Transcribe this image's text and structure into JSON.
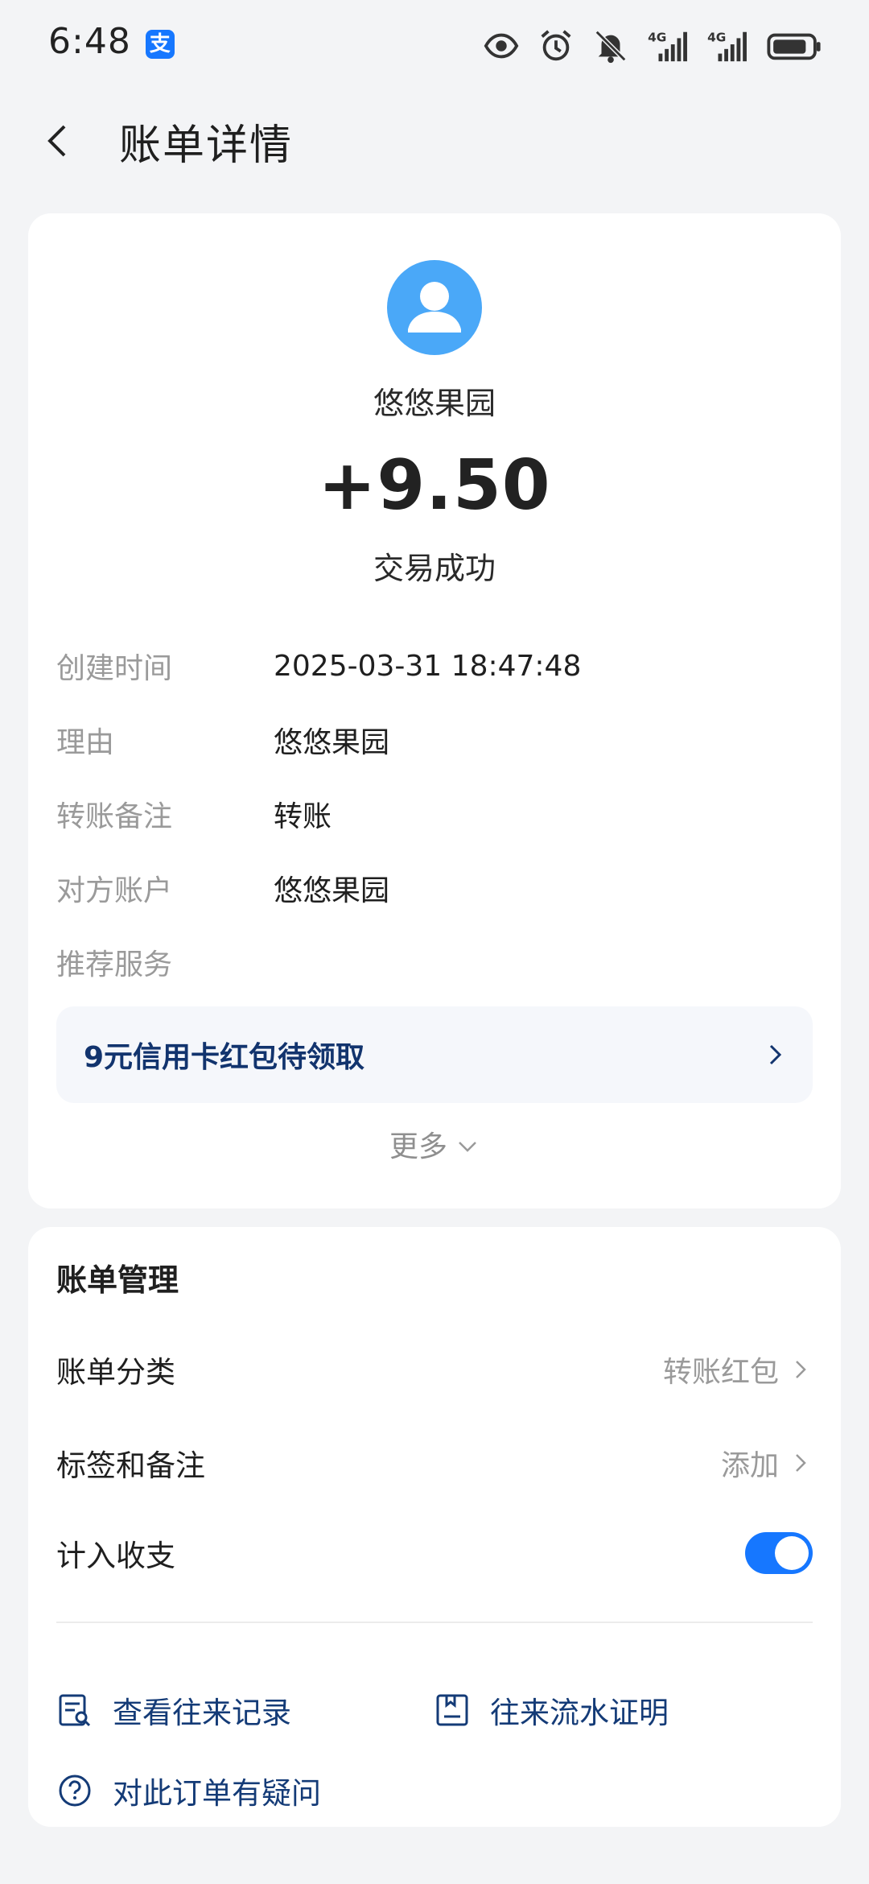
{
  "status_bar": {
    "time": "6:48",
    "app_badge": "支",
    "icons": [
      "eye-icon",
      "alarm-icon",
      "mute-bell-icon",
      "signal-4g-icon",
      "signal-4g-icon",
      "battery-icon"
    ],
    "network_labels": [
      "4G",
      "4G"
    ]
  },
  "header": {
    "title": "账单详情"
  },
  "transaction": {
    "payee": "悠悠果园",
    "amount": "+9.50",
    "status": "交易成功"
  },
  "details": [
    {
      "label": "创建时间",
      "value": "2025-03-31 18:47:48"
    },
    {
      "label": "理由",
      "value": "悠悠果园"
    },
    {
      "label": "转账备注",
      "value": "转账"
    },
    {
      "label": "对方账户",
      "value": "悠悠果园"
    },
    {
      "label": "推荐服务",
      "value": ""
    }
  ],
  "promo": {
    "text": "9元信用卡红包待领取"
  },
  "more_label": "更多",
  "manage": {
    "title": "账单管理",
    "category": {
      "label": "账单分类",
      "value": "转账红包"
    },
    "tags": {
      "label": "标签和备注",
      "value": "添加"
    },
    "include": {
      "label": "计入收支",
      "enabled": true
    },
    "links": {
      "history": "查看往来记录",
      "proof": "往来流水证明",
      "question": "对此订单有疑问"
    }
  },
  "colors": {
    "accent": "#1677ff",
    "avatar": "#4aa8f8",
    "link": "#143b77",
    "background": "#f3f4f6"
  }
}
